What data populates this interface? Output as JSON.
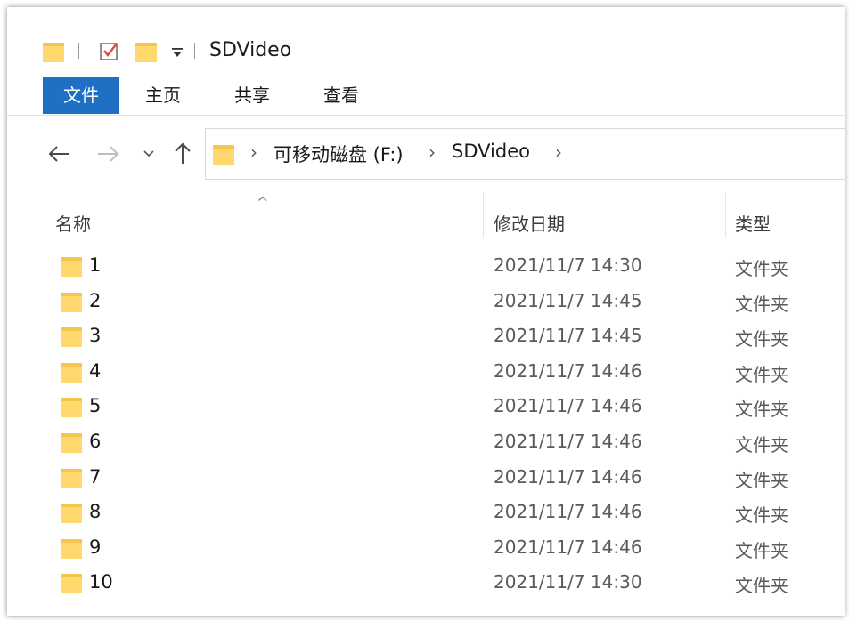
{
  "window": {
    "title": "SDVideo"
  },
  "quick_access": {
    "folder_icon": "folder-icon",
    "check_icon": "checkbox-icon",
    "dropdown_icon": "dropdown-arrow-icon"
  },
  "ribbon": {
    "tabs": [
      {
        "label": "文件",
        "active": true
      },
      {
        "label": "主页"
      },
      {
        "label": "共享"
      },
      {
        "label": "查看"
      }
    ]
  },
  "nav": {
    "back": "←",
    "forward": "→",
    "recent": "⌄",
    "up": "↑"
  },
  "address": {
    "crumbs": [
      "可移动磁盘 (F:)",
      "SDVideo"
    ]
  },
  "columns": {
    "name": "名称",
    "date": "修改日期",
    "type": "类型"
  },
  "files": [
    {
      "name": "1",
      "date": "2021/11/7 14:30",
      "type": "文件夹"
    },
    {
      "name": "2",
      "date": "2021/11/7 14:45",
      "type": "文件夹"
    },
    {
      "name": "3",
      "date": "2021/11/7 14:45",
      "type": "文件夹"
    },
    {
      "name": "4",
      "date": "2021/11/7 14:46",
      "type": "文件夹"
    },
    {
      "name": "5",
      "date": "2021/11/7 14:46",
      "type": "文件夹"
    },
    {
      "name": "6",
      "date": "2021/11/7 14:46",
      "type": "文件夹"
    },
    {
      "name": "7",
      "date": "2021/11/7 14:46",
      "type": "文件夹"
    },
    {
      "name": "8",
      "date": "2021/11/7 14:46",
      "type": "文件夹"
    },
    {
      "name": "9",
      "date": "2021/11/7 14:46",
      "type": "文件夹"
    },
    {
      "name": "10",
      "date": "2021/11/7 14:30",
      "type": "文件夹"
    }
  ],
  "colors": {
    "accent": "#1f6fc5",
    "folder": "#ffd86e",
    "folder_back": "#f5c64f",
    "check": "#e2483d"
  }
}
